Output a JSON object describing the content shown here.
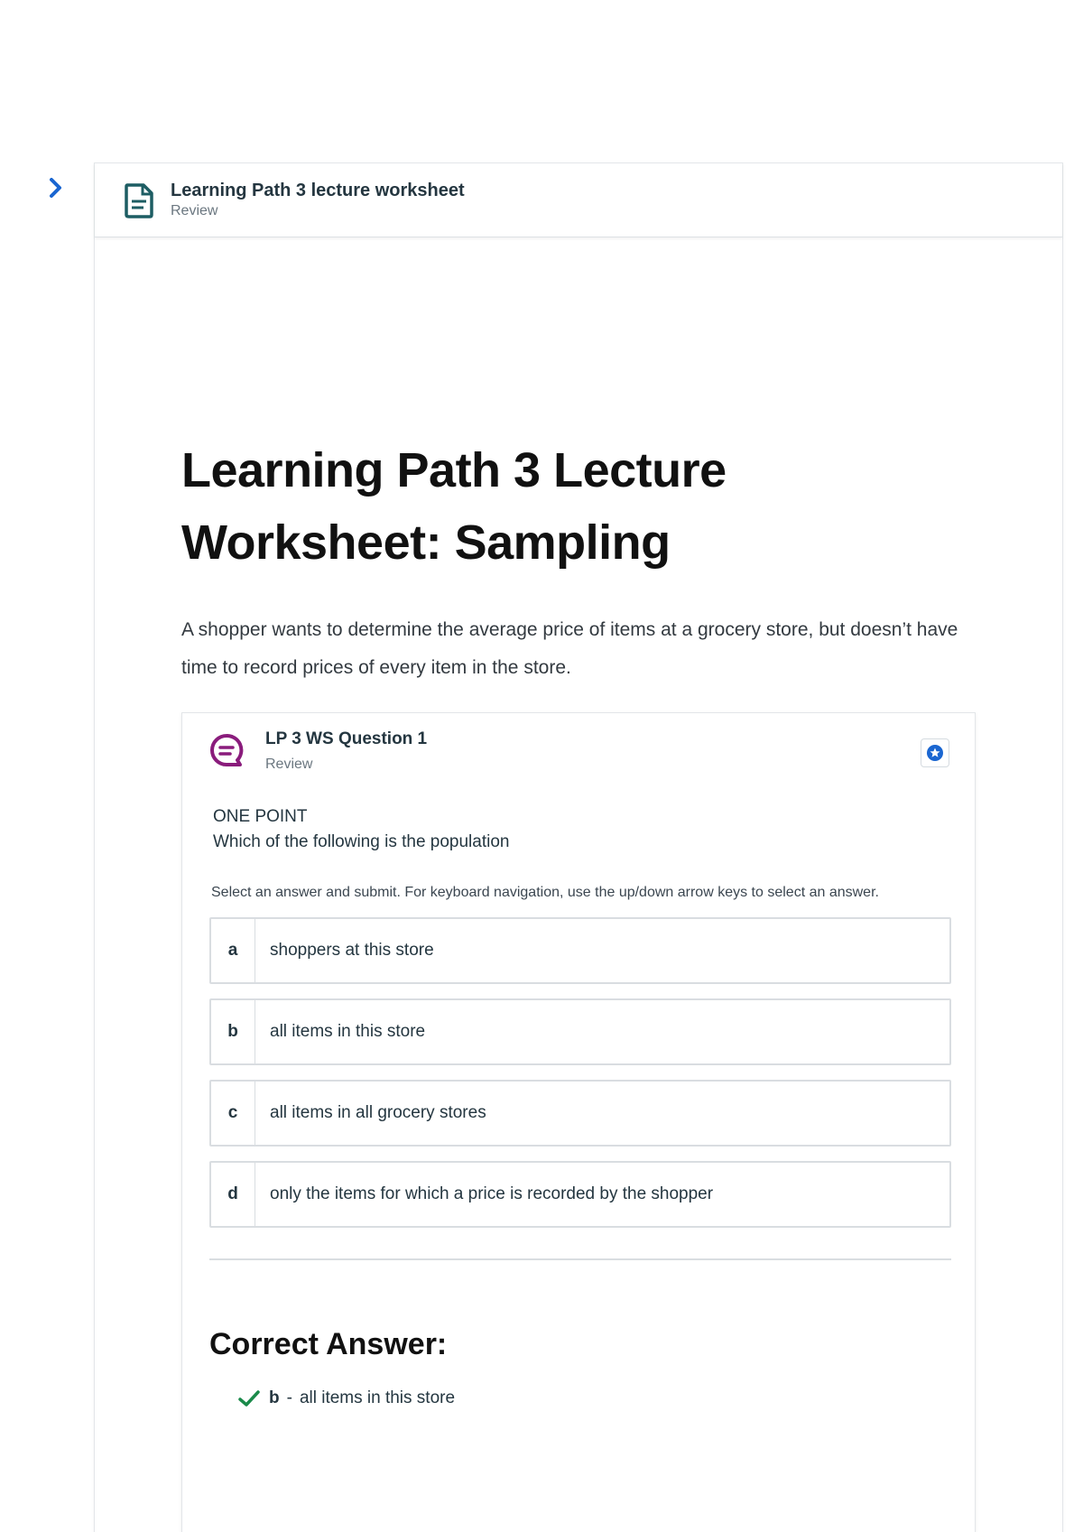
{
  "header": {
    "title": "Learning Path 3 lecture worksheet",
    "subtitle": "Review"
  },
  "main": {
    "title": "Learning Path 3 Lecture Worksheet: Sampling",
    "intro": "A shopper wants to determine the average price of items at a grocery store, but doesn’t have time to record prices of every item in the store."
  },
  "question": {
    "title": "LP 3 WS Question 1",
    "subtitle": "Review",
    "points": "ONE POINT",
    "text": "Which of the following is the population",
    "instructions": "Select an answer and submit. For keyboard navigation, use the up/down arrow keys to select an answer.",
    "options": [
      {
        "letter": "a",
        "text": "shoppers at this store"
      },
      {
        "letter": "b",
        "text": "all items in this store"
      },
      {
        "letter": "c",
        "text": "all items in all grocery stores"
      },
      {
        "letter": "d",
        "text": "only the items for which a price is recorded by the shopper"
      }
    ]
  },
  "correct": {
    "heading": "Correct Answer:",
    "letter": "b",
    "separator": "-",
    "text": "all items in this store"
  },
  "icons": {
    "expand": "chevron-right-icon",
    "document": "document-icon",
    "chat": "chat-bubble-icon",
    "badge": "badge-icon",
    "check": "checkmark-icon"
  },
  "colors": {
    "accent_blue": "#1a66d1",
    "doc_icon_teal": "#1d5d63",
    "chat_icon_purple": "#8a1c7c",
    "check_green": "#1a8a4a"
  }
}
